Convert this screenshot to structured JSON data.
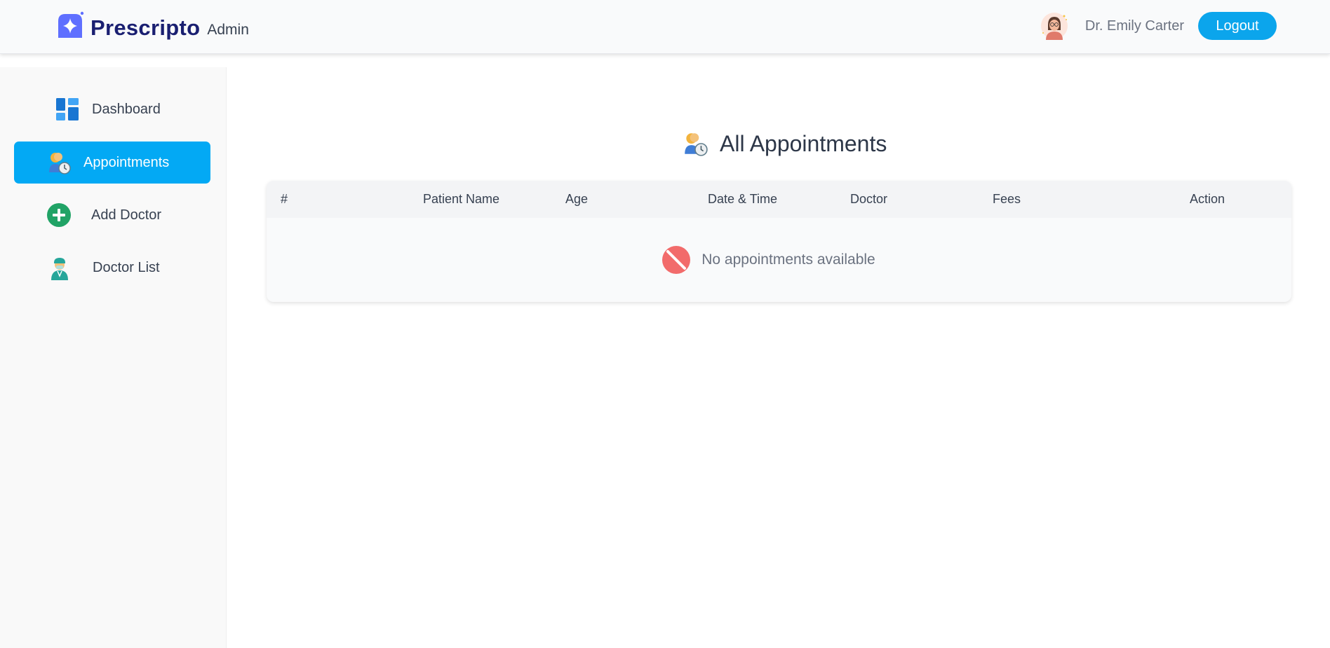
{
  "header": {
    "brand_name": "Prescripto",
    "brand_suffix": "Admin",
    "user_name": "Dr. Emily Carter",
    "logout_label": "Logout",
    "logo_icon": "prescripto-logo-icon",
    "avatar_icon": "user-avatar"
  },
  "sidebar": {
    "items": [
      {
        "label": "Dashboard",
        "icon": "dashboard-icon",
        "active": false
      },
      {
        "label": "Appointments",
        "icon": "appointments-icon",
        "active": true
      },
      {
        "label": "Add Doctor",
        "icon": "add-doctor-icon",
        "active": false
      },
      {
        "label": "Doctor List",
        "icon": "doctor-list-icon",
        "active": false
      }
    ]
  },
  "main": {
    "title": "All Appointments",
    "title_icon": "appointments-icon",
    "table": {
      "columns": [
        "#",
        "Patient Name",
        "Age",
        "Date & Time",
        "Doctor",
        "Fees",
        "Action"
      ],
      "empty_message": "No appointments available",
      "empty_icon": "no-entry-icon"
    }
  },
  "colors": {
    "accent": "#03a9f4",
    "logout_button": "#0ba5ec",
    "brand_text": "#1a1f71",
    "logo": "#5f6fff",
    "no_entry": "#f26b6b"
  }
}
